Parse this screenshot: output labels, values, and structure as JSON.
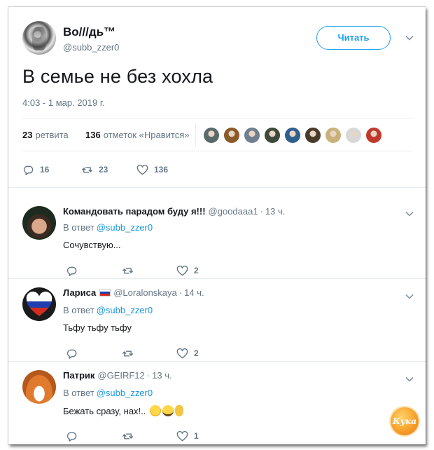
{
  "main_tweet": {
    "author_name": "Во///дь™",
    "author_handle": "@subb_zzer0",
    "follow_label": "Читать",
    "text": "В семье не без хохла",
    "timestamp": "4:03 - 1 мар. 2019 г.",
    "retweets_count": "23",
    "retweets_label": "ретвита",
    "likes_count": "136",
    "likes_label": "отметок «Нравится»",
    "likers_avatars": [
      "#5a6a6a",
      "#8b5a2b",
      "#6f7f8f",
      "#3d4a3a",
      "#2f5f8f",
      "#4a3a2a",
      "#c9b27a",
      "#d8d8d8",
      "#c0392b"
    ],
    "actions": {
      "replies": "16",
      "retweets": "23",
      "likes": "136"
    }
  },
  "replies": [
    {
      "name": "Командовать парадом буду я!!!",
      "handle": "@goodaaa1",
      "separator": "·",
      "time": "13 ч.",
      "reply_prefix": "В ответ",
      "reply_to": "@subb_zzer0",
      "text": "Сочувствую...",
      "reply_count": "",
      "retweet_count": "",
      "like_count": "2"
    },
    {
      "name": "Лариса",
      "handle": "@Loralonskaya",
      "separator": "·",
      "time": "14 ч.",
      "reply_prefix": "В ответ",
      "reply_to": "@subb_zzer0",
      "text": "Тьфу тьфу тьфу",
      "reply_count": "",
      "retweet_count": "",
      "like_count": "2"
    },
    {
      "name": "Патрик",
      "handle": "@GEIRF12",
      "separator": "·",
      "time": "13 ч.",
      "reply_prefix": "В ответ",
      "reply_to": "@subb_zzer0",
      "text": "Бежать сразу, нах!..",
      "reply_count": "",
      "retweet_count": "",
      "like_count": "1"
    }
  ],
  "watermark": {
    "text": "Кука"
  },
  "colors": {
    "accent": "#1da1f2",
    "mention": "#1b95e0",
    "muted": "#657786",
    "divider": "#e6ecf0"
  }
}
